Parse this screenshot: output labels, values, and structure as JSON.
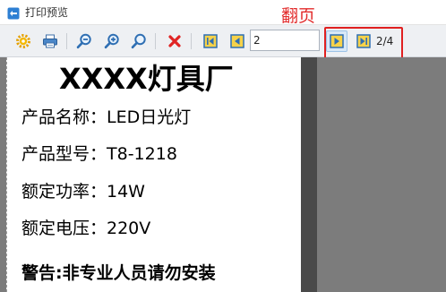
{
  "window": {
    "title": "打印预览",
    "icon": "print-preview-app-icon"
  },
  "annotation": {
    "text": "翻页",
    "color": "#e22b2b"
  },
  "toolbar": {
    "buttons": [
      {
        "name": "settings-button",
        "icon": "gear-icon"
      },
      {
        "name": "print-button",
        "icon": "printer-icon"
      },
      {
        "name": "zoom-out-button",
        "icon": "zoom-out-icon"
      },
      {
        "name": "zoom-in-button",
        "icon": "zoom-in-icon"
      },
      {
        "name": "zoom-fit-button",
        "icon": "zoom-icon"
      },
      {
        "name": "close-button",
        "icon": "close-icon"
      },
      {
        "name": "first-page-button",
        "icon": "first-page-icon"
      },
      {
        "name": "prev-page-button",
        "icon": "prev-page-icon"
      },
      {
        "name": "next-page-button",
        "icon": "next-page-icon"
      },
      {
        "name": "last-page-button",
        "icon": "last-page-icon"
      }
    ],
    "page_input_value": "2",
    "page_count": "2/4"
  },
  "document": {
    "title": "XXXX灯具厂",
    "lines": [
      "产品名称：LED日光灯",
      "产品型号：T8-1218",
      "额定功率：14W",
      "额定电压：220V"
    ],
    "warning": "警告:非专业人员请勿安装"
  },
  "colors": {
    "highlight_border": "#e02020",
    "preview_background": "#7c7c7c",
    "nav_icon_fill": "#f6d24a",
    "nav_icon_border": "#2f6fb3"
  }
}
